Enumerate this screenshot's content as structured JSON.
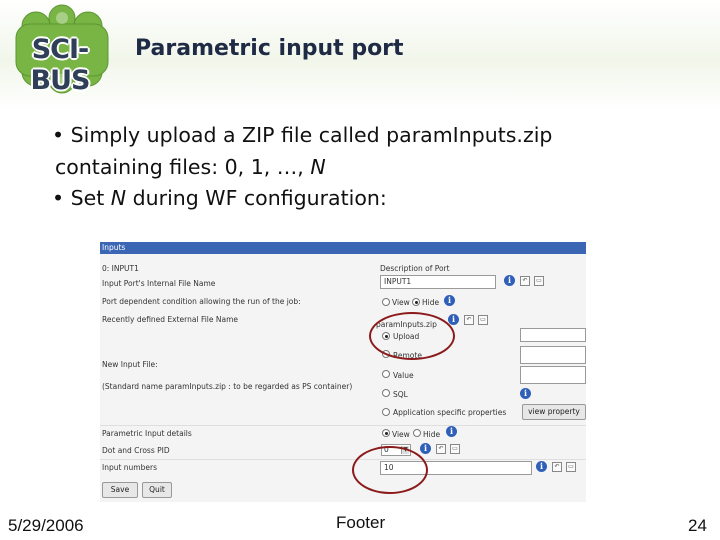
{
  "header": {
    "logo_text": "SCI-BUS",
    "title": "Parametric input port"
  },
  "bullets": {
    "line1": "• Simply upload a ZIP file called paramInputs.zip",
    "line2_prefix": "containing files: 0, 1, …, ",
    "line2_var": "N",
    "line3_prefix": "• Set ",
    "line3_var": "N",
    "line3_suffix": " during WF configuration:"
  },
  "panel": {
    "head": "Inputs",
    "port_id": "0:  INPUT1",
    "port_desc_label": "Description of Port",
    "row_internal_name": "Input Port's Internal File Name",
    "internal_name_value": "INPUT1",
    "row_dependent": "Port dependent condition allowing the run of the job:",
    "view_label": "View",
    "hide_label": "Hide",
    "row_recent": "Recently defined External File Name",
    "recent_value": "paramInputs.zip",
    "opt_upload": "Upload",
    "opt_remote": "Remote",
    "opt_value": "Value",
    "opt_sql": "SQL",
    "opt_app": "Application specific properties",
    "view_property_btn": "view property",
    "row_new_input": "New Input File:",
    "row_standard_name": "(Standard name paramInputs.zip : to be regarded as PS container)",
    "row_param_details": "Parametric Input details",
    "row_dot_cross": "Dot and Cross PID",
    "dot_cross_value": "0",
    "row_input_numbers": "Input numbers",
    "input_numbers_value": "10",
    "save_btn": "Save",
    "quit_btn": "Quit"
  },
  "footer": {
    "date": "5/29/2006",
    "center": "Footer",
    "page": "24"
  },
  "colors": {
    "panel_header": "#3b66b4",
    "highlight_ring": "#8b1a1a",
    "logo_green": "#7ab648"
  }
}
